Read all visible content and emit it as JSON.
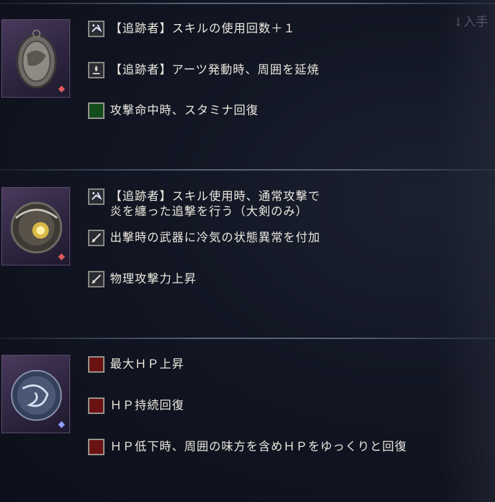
{
  "colors": {
    "background": "#121623",
    "text": "#ece8df",
    "red_gem": "#d95c5c",
    "blue_gem": "#8ea0ff"
  },
  "corner_label": "↓入手",
  "relics": [
    {
      "icon": "oval-medallion-icon",
      "rarity_color": "#d95c5c",
      "effects": [
        {
          "icon": "sparkle-skill-icon",
          "text": "【追跡者】スキルの使用回数＋１"
        },
        {
          "icon": "flame-art-icon",
          "text": "【追跡者】アーツ発動時、周囲を延焼"
        },
        {
          "icon": "green-square-icon",
          "text": "攻撃命中時、スタミナ回復"
        }
      ]
    },
    {
      "icon": "glowing-nest-icon",
      "rarity_color": "#d95c5c",
      "effects": [
        {
          "icon": "sparkle-skill-icon",
          "text": "【追跡者】スキル使用時、通常攻撃で\n炎を纏った追撃を行う（大剣のみ）"
        },
        {
          "icon": "sword-icon",
          "text": "出撃時の武器に冷気の状態異常を付加"
        },
        {
          "icon": "sword-icon",
          "text": "物理攻撃力上昇"
        }
      ]
    },
    {
      "icon": "crystal-swirl-icon",
      "rarity_color": "#8ea0ff",
      "effects": [
        {
          "icon": "red-square-icon",
          "text": "最大ＨＰ上昇"
        },
        {
          "icon": "red-square-icon",
          "text": "ＨＰ持続回復"
        },
        {
          "icon": "red-square-icon",
          "text": "ＨＰ低下時、周囲の味方を含めＨＰをゆっくりと回復"
        }
      ]
    }
  ]
}
